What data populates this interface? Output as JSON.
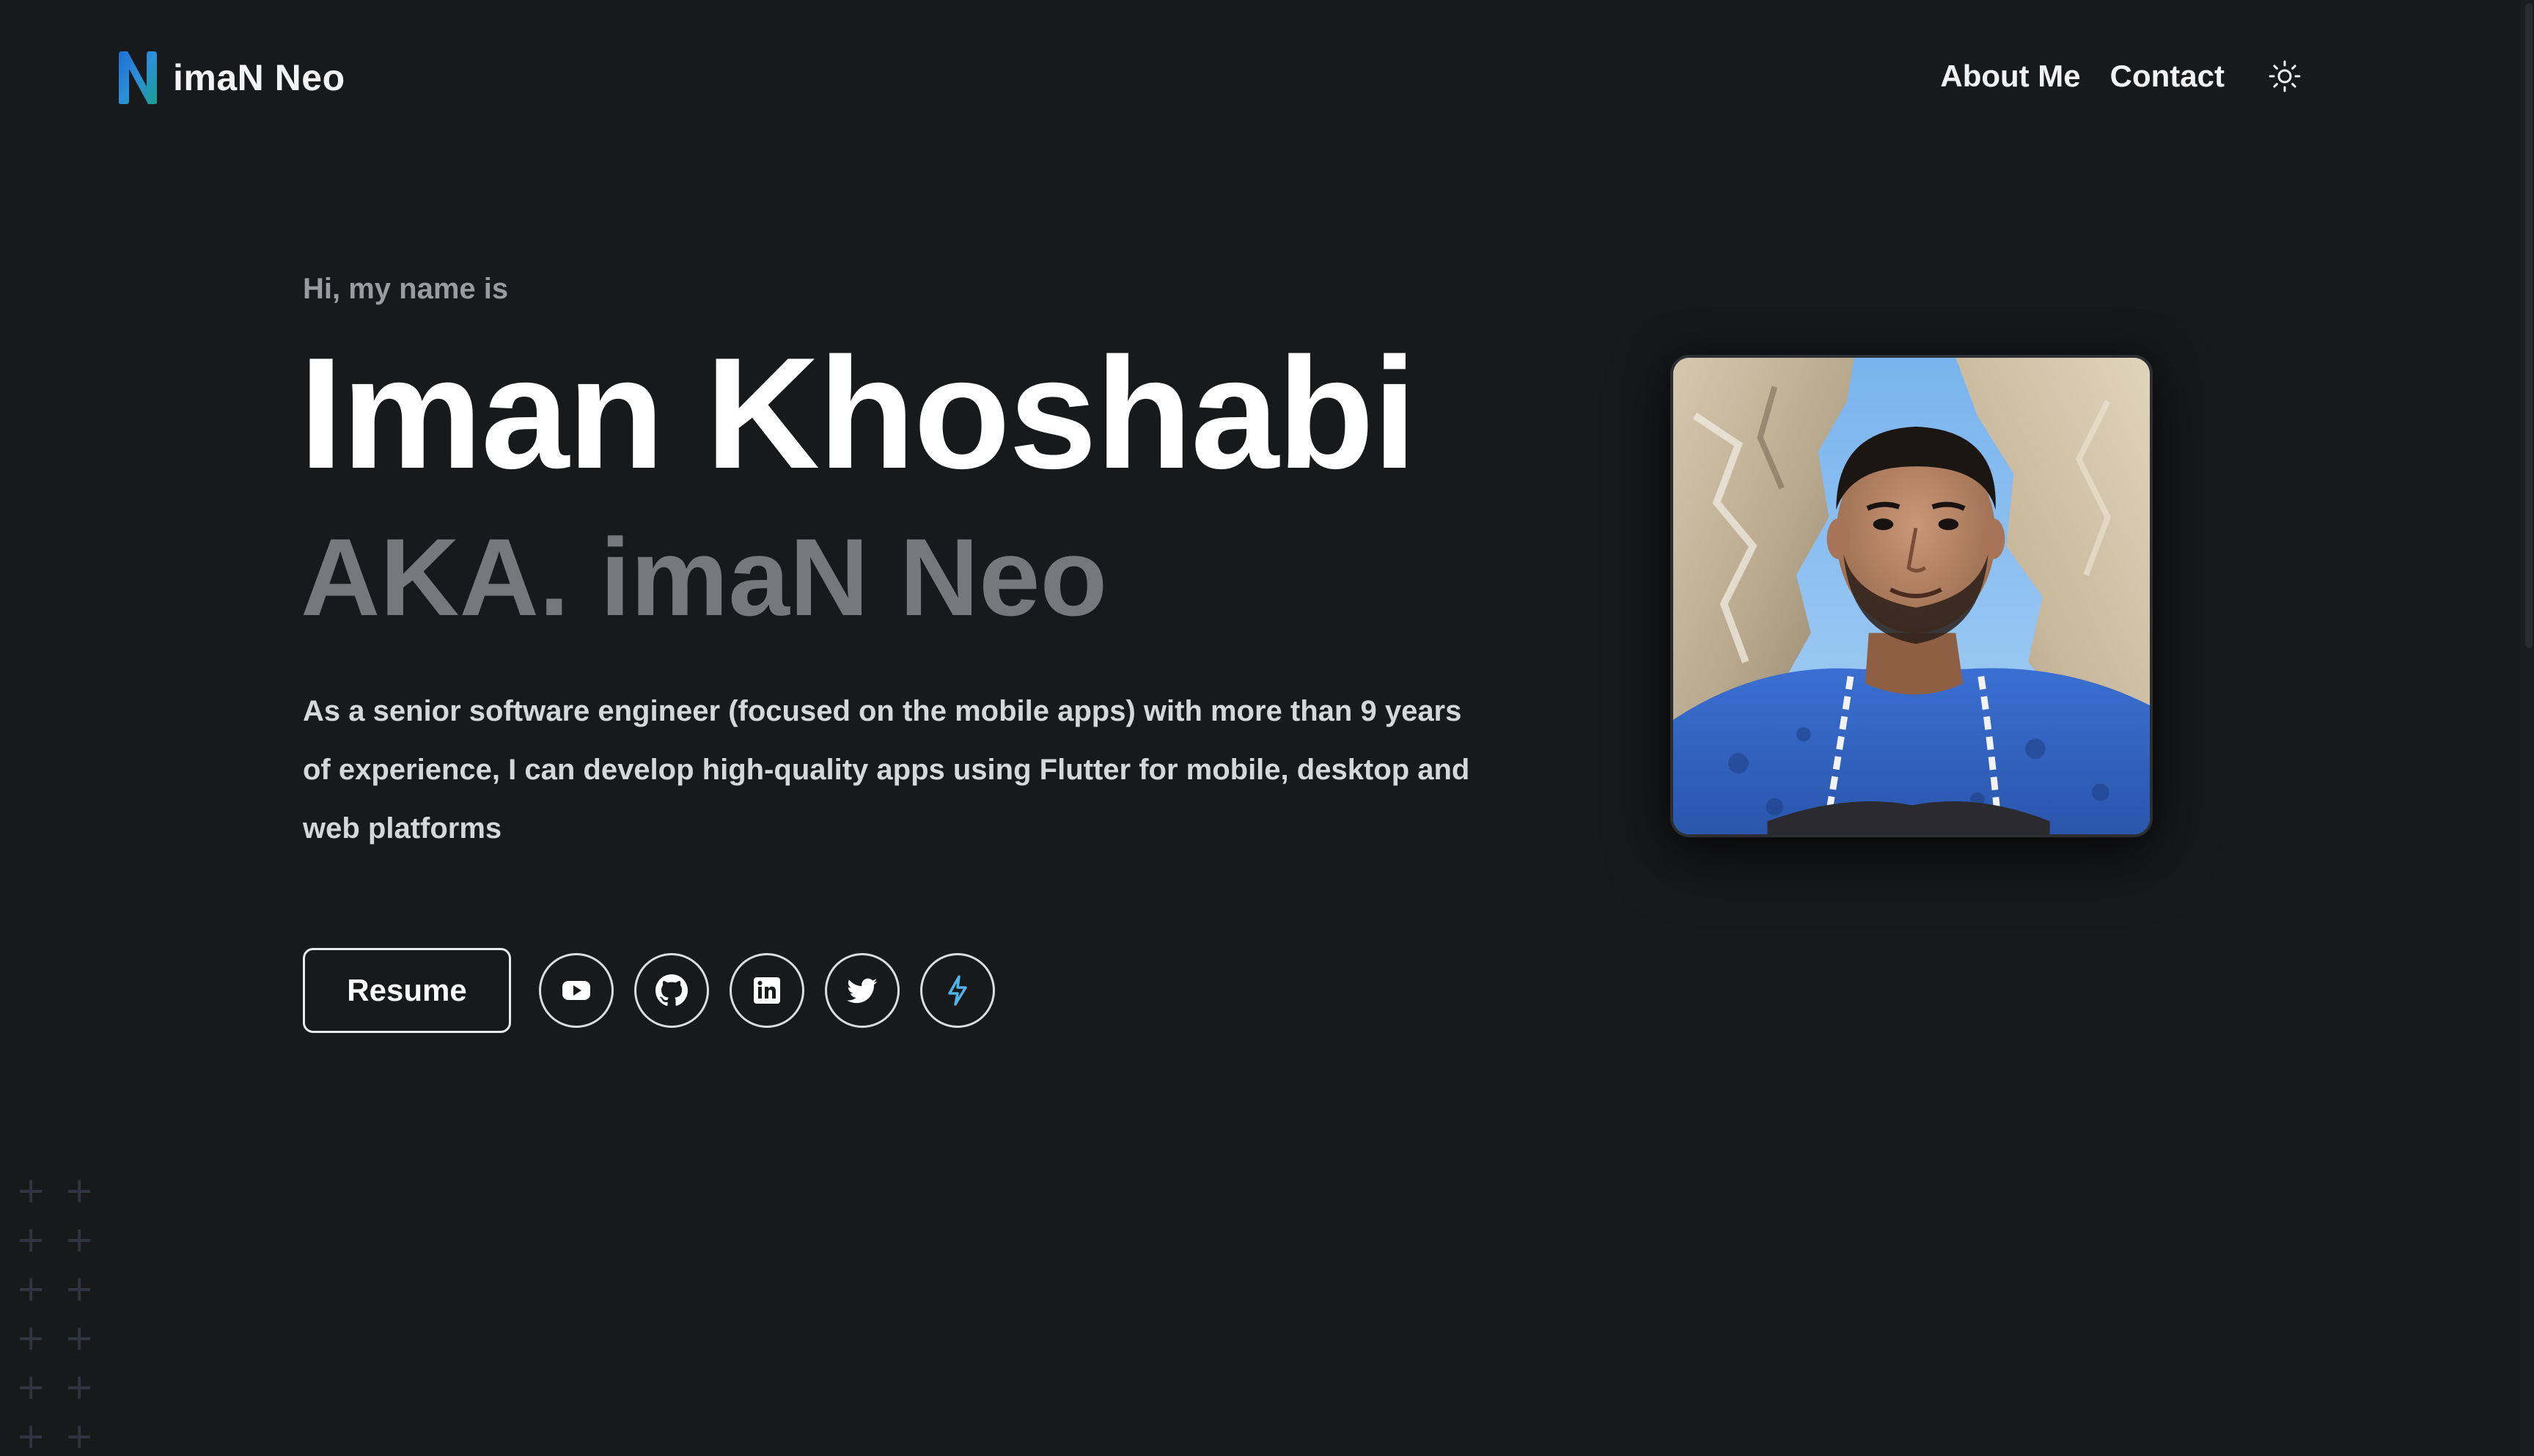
{
  "header": {
    "logo_text": "imaN Neo",
    "nav": [
      {
        "label": "About Me"
      },
      {
        "label": "Contact"
      }
    ],
    "theme_toggle_icon": "sun-icon"
  },
  "hero": {
    "greeting": "Hi, my name is",
    "name": "Iman Khoshabi",
    "aka": "AKA. imaN Neo",
    "bio": "As a senior software engineer (focused on the mobile apps) with more than 9 years of experience, I can develop high-quality apps using Flutter for mobile, desktop and web platforms",
    "resume_label": "Resume",
    "socials": [
      {
        "icon": "youtube-icon"
      },
      {
        "icon": "github-icon"
      },
      {
        "icon": "linkedin-icon"
      },
      {
        "icon": "twitter-icon"
      },
      {
        "icon": "lightning-icon"
      }
    ],
    "photo_icon": "profile-photo"
  },
  "colors": {
    "background": "#18191b",
    "text_primary": "#ffffff",
    "text_muted": "#77787b",
    "logo_blue": "#2f7fd8",
    "lightning_blue": "#4fb3e8"
  }
}
